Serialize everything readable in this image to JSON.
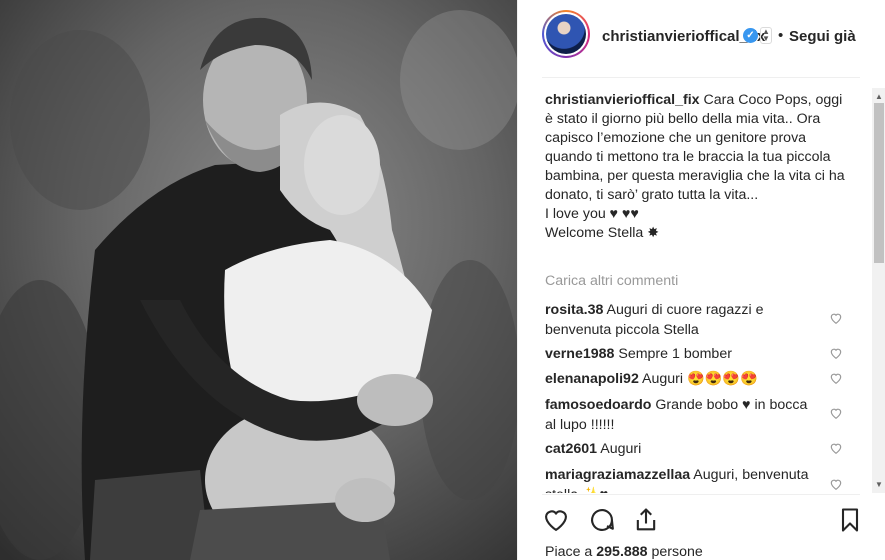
{
  "header": {
    "username": "christianvierioffical_fix",
    "follow_status": "Segui già",
    "separator": "•"
  },
  "post": {
    "caption_user": "christianvierioffical_fix",
    "caption_text": "Cara Coco Pops, oggi è stato il giorno più bello della mia vita.. Ora capisco l’emozione che un genitore prova quando ti mettono tra le braccia la tua piccola bambina, per questa meraviglia che la vita ci ha donato, ti sarò’ grato tutta la vita...",
    "caption_line2": "I love you ♥ ♥♥",
    "caption_line3": "Welcome Stella ✸",
    "load_more": "Carica altri commenti"
  },
  "comments": [
    {
      "user": "rosita.38",
      "text": "Auguri di cuore ragazzi e benvenuta piccola Stella"
    },
    {
      "user": "verne1988",
      "text": "Sempre 1 bomber"
    },
    {
      "user": "elenanapoli92",
      "text": "Auguri 😍😍😍😍"
    },
    {
      "user": "famosoedoardo",
      "text": "Grande bobo ♥ in bocca al lupo !!!!!!"
    },
    {
      "user": "cat2601",
      "text": "Auguri"
    },
    {
      "user": "mariagraziamazzellaa",
      "text": "Auguri, benvenuta stella ✨♥"
    }
  ],
  "likes": {
    "prefix": "Piace a",
    "count": "295.888",
    "suffix": "persone"
  },
  "icons": {
    "like": "heart-icon",
    "comment": "comment-icon",
    "share": "share-icon",
    "save": "bookmark-icon",
    "verified": "verified-badge-icon"
  },
  "colors": {
    "verified": "#3897f0",
    "text": "#262626",
    "muted": "#999999"
  }
}
